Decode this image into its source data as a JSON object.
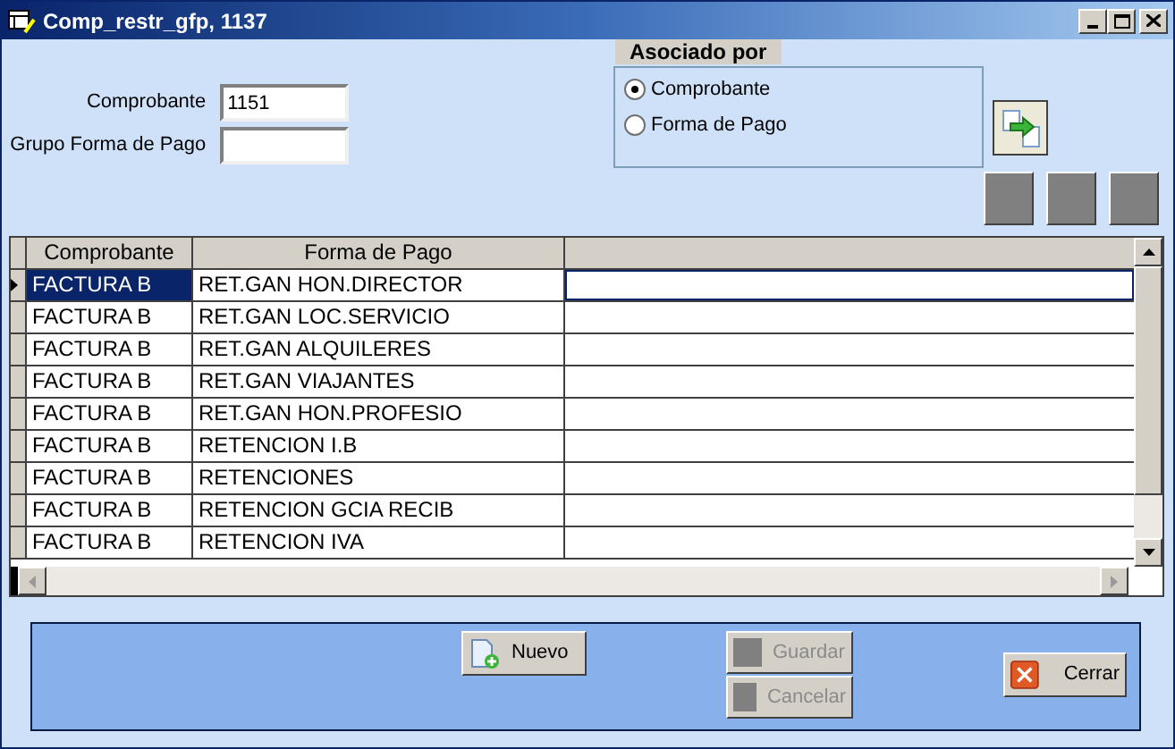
{
  "window": {
    "title": "Comp_restr_gfp, 1137"
  },
  "fields": [
    {
      "label": "Comprobante",
      "value": "1151"
    },
    {
      "label": "Grupo Forma de Pago"
    }
  ],
  "asociado_por": {
    "title": "Asociado por",
    "options": [
      {
        "label": "Comprobante",
        "selected": true
      },
      {
        "label": "Forma de Pago",
        "selected": false
      }
    ]
  },
  "table": {
    "columns": [
      "Comprobante",
      "Forma de Pago"
    ],
    "rows": [
      {
        "cells": [
          "FACTURA B",
          "RET.GAN HON.DIRECTOR"
        ],
        "selected": true
      },
      {
        "cells": [
          "FACTURA B",
          "RET.GAN LOC.SERVICIO"
        ],
        "selected": false
      },
      {
        "cells": [
          "FACTURA B",
          "RET.GAN ALQUILERES"
        ],
        "selected": false
      },
      {
        "cells": [
          "FACTURA B",
          "RET.GAN VIAJANTES"
        ],
        "selected": false
      },
      {
        "cells": [
          "FACTURA B",
          "RET.GAN HON.PROFESIO"
        ],
        "selected": false
      },
      {
        "cells": [
          "FACTURA B",
          "RETENCION I.B"
        ],
        "selected": false
      },
      {
        "cells": [
          "FACTURA B",
          "RETENCIONES"
        ],
        "selected": false
      },
      {
        "cells": [
          "FACTURA B",
          "RETENCION GCIA RECIB"
        ],
        "selected": false
      },
      {
        "cells": [
          "FACTURA B",
          "RETENCION IVA"
        ],
        "selected": false
      }
    ]
  },
  "buttons": [
    {
      "label": "Nuevo",
      "kind": "new",
      "disabled": false
    },
    {
      "label": "Guardar",
      "kind": "save",
      "disabled": true
    },
    {
      "label": "Cancelar",
      "kind": "cancel",
      "disabled": true
    },
    {
      "label": "Cerrar",
      "kind": "close",
      "disabled": false
    }
  ]
}
